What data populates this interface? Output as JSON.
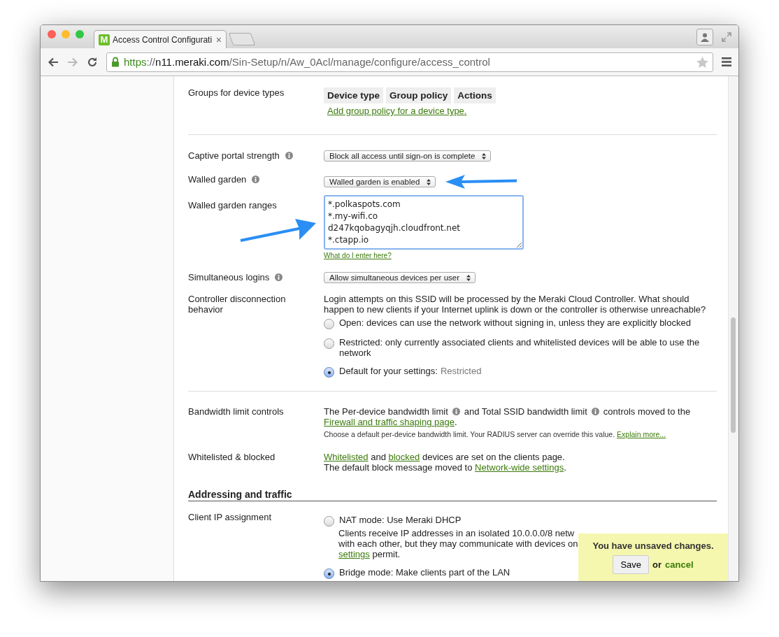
{
  "browser": {
    "favicon": "M",
    "tab_title": "Access Control Configurati",
    "tab_close": "×",
    "url_scheme": "https",
    "url_sep": "://",
    "url_host": "n11.meraki.com",
    "url_path": "/Sin-Setup/n/Aw_0Acl/manage/configure/access_control"
  },
  "settings": [
    {
      "kind": "table",
      "label": "Groups for device types",
      "columns": [
        "Device type",
        "Group policy",
        "Actions"
      ],
      "link": "Add group policy for a device type."
    },
    {
      "kind": "divider"
    },
    {
      "kind": "select",
      "label": "Captive portal strength",
      "info": true,
      "value": "Block all access until sign-on is complete"
    },
    {
      "kind": "select",
      "label": "Walled garden",
      "info": true,
      "value": "Walled garden is enabled",
      "arrow": true
    },
    {
      "kind": "textarea",
      "label": "Walled garden ranges",
      "value": "*.polkaspots.com\n*.my-wifi.co\nd247kqobagyqjh.cloudfront.net\n*.ctapp.io",
      "help": "What do I enter here?",
      "arrow": true
    },
    {
      "kind": "select",
      "label": "Simultaneous logins",
      "info": true,
      "value": "Allow simultaneous devices per user"
    },
    {
      "kind": "radios",
      "label": "Controller disconnection behavior",
      "intro": "Login attempts on this SSID will be processed by the Meraki Cloud Controller. What should happen to new clients if your Internet uplink is down or the controller is otherwise unreachable?",
      "options": [
        {
          "label": "Open: devices can use the network without signing in, unless they are explicitly blocked",
          "selected": false
        },
        {
          "label": "Restricted: only currently associated clients and whitelisted devices will be able to use the network",
          "selected": false
        },
        {
          "label": "Default for your settings:",
          "note": "Restricted",
          "selected": true
        }
      ]
    },
    {
      "kind": "divider"
    },
    {
      "kind": "bandwidth",
      "label": "Bandwidth limit controls",
      "parts": [
        {
          "text": "The Per-device bandwidth limit"
        },
        {
          "info": true
        },
        {
          "text": "and Total SSID bandwidth limit"
        },
        {
          "info": true
        },
        {
          "text": "controls moved to the"
        },
        {
          "link": "Firewall and traffic shaping page"
        },
        {
          "text": "."
        }
      ],
      "note": "Choose a default per-device bandwidth limit. Your RADIUS server can override this value.",
      "note_link": "Explain more..."
    },
    {
      "kind": "lines",
      "label": "Whitelisted & blocked",
      "lines": [
        [
          {
            "link": "Whitelisted"
          },
          {
            "text": " and "
          },
          {
            "link": "blocked"
          },
          {
            "text": " devices are set on the clients page."
          }
        ],
        [
          {
            "text": "The default block message moved to "
          },
          {
            "link": "Network-wide settings"
          },
          {
            "text": "."
          }
        ]
      ]
    },
    {
      "kind": "heading",
      "text": "Addressing and traffic"
    },
    {
      "kind": "radios",
      "label": "Client IP assignment",
      "options": [
        {
          "label": "NAT mode: Use Meraki DHCP",
          "selected": false,
          "description": [
            [
              {
                "text": "Clients receive IP addresses in an isolated 10.0.0.0/8 netw"
              }
            ],
            [
              {
                "text": "with each other, but they may communicate with devices on"
              }
            ],
            [
              {
                "link": "settings"
              },
              {
                "text": " permit."
              }
            ]
          ]
        },
        {
          "label": "Bridge mode: Make clients part of the LAN",
          "selected": true
        }
      ]
    }
  ],
  "unsaved": {
    "message": "You have unsaved changes.",
    "save": "Save",
    "or": "or",
    "cancel": "cancel"
  }
}
